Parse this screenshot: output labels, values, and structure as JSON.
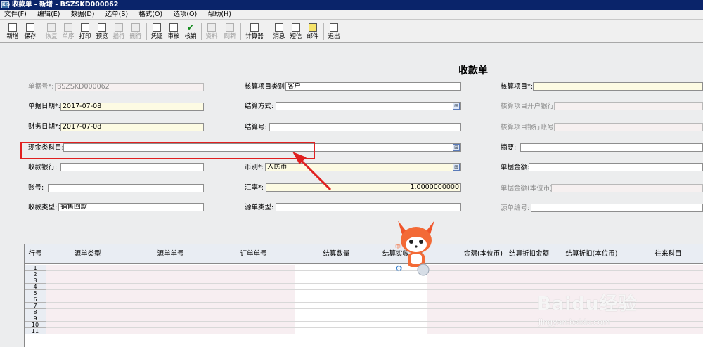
{
  "window": {
    "title": "收款单 - 新增 - BSZSKD000062",
    "app_icon": "KIS"
  },
  "menu": [
    "文件(F)",
    "编辑(E)",
    "数据(D)",
    "选单(S)",
    "格式(O)",
    "选项(O)",
    "帮助(H)"
  ],
  "toolbar": [
    {
      "label": "新增",
      "icon": "new-doc-icon",
      "enabled": true
    },
    {
      "label": "保存",
      "icon": "save-icon",
      "enabled": true
    },
    {
      "label": "恢复",
      "icon": "undo-icon",
      "enabled": false
    },
    {
      "label": "单序",
      "icon": "sequence-icon",
      "enabled": false
    },
    {
      "label": "打印",
      "icon": "print-icon",
      "enabled": true
    },
    {
      "label": "预览",
      "icon": "preview-icon",
      "enabled": true
    },
    {
      "label": "插行",
      "icon": "insert-row-icon",
      "enabled": false
    },
    {
      "label": "删行",
      "icon": "delete-row-icon",
      "enabled": false
    },
    {
      "label": "凭证",
      "icon": "voucher-icon",
      "enabled": true
    },
    {
      "label": "审核",
      "icon": "audit-icon",
      "enabled": true
    },
    {
      "label": "核销",
      "icon": "checkmark-icon",
      "enabled": true
    },
    {
      "label": "资料",
      "icon": "info-icon",
      "enabled": false
    },
    {
      "label": "刷新",
      "icon": "refresh-icon",
      "enabled": false
    },
    {
      "label": "计算器",
      "icon": "calculator-icon",
      "enabled": true
    },
    {
      "label": "消息",
      "icon": "message-icon",
      "enabled": true
    },
    {
      "label": "短信",
      "icon": "sms-icon",
      "enabled": true
    },
    {
      "label": "邮件",
      "icon": "mail-icon",
      "enabled": true
    },
    {
      "label": "退出",
      "icon": "exit-icon",
      "enabled": true
    }
  ],
  "document_title": "收款单",
  "form": {
    "bill_no_label": "单据号*:",
    "bill_no": "BSZSKD000062",
    "bill_date_label": "单据日期*:",
    "bill_date": "2017-07-08",
    "fin_date_label": "财务日期*:",
    "fin_date": "2017-07-08",
    "cash_account_label": "现金类科目:",
    "cash_account": "",
    "bank_label": "收款银行:",
    "bank": "",
    "account_label": "账号:",
    "account": "",
    "receipt_type_label": "收款类型:",
    "receipt_type": "销售回款",
    "item_category_label": "核算项目类别:",
    "item_category": "客户",
    "settle_method_label": "结算方式:",
    "settle_method": "",
    "settle_no_label": "结算号:",
    "settle_no": "",
    "summary_label": "摘要:",
    "summary": "",
    "currency_label": "币别*:",
    "currency": "人民币",
    "rate_label": "汇率*:",
    "rate": "1.0000000000",
    "source_type_label": "源单类型:",
    "source_type": "",
    "item_label": "核算项目*:",
    "item": "",
    "item_bank_label": "核算项目开户银行:",
    "item_bank": "",
    "item_bank_account_label": "核算项目银行账号:",
    "item_bank_account": "",
    "amount_label": "单据金额:",
    "amount": "",
    "amount_local_label": "单据金额(本位币):",
    "amount_local": "",
    "source_no_label": "源单编号:",
    "source_no": ""
  },
  "grid": {
    "columns": [
      "行号",
      "源单类型",
      "源单单号",
      "订单单号",
      "结算数量",
      "结算实收金额",
      "金额(本位币)",
      "结算折扣金额",
      "结算折扣(本位币)",
      "往来科目"
    ],
    "rows": [
      "1",
      "2",
      "3",
      "4",
      "5",
      "6",
      "7",
      "8",
      "9",
      "10",
      "11"
    ]
  },
  "watermark": {
    "brand": "Baidu经验",
    "url": "jingyan.baidu.com"
  },
  "colors": {
    "title_bar": "#0a246a",
    "highlight_box": "#e02020",
    "required_field": "#fdfbe3",
    "readonly_field": "#f6f0f0"
  }
}
